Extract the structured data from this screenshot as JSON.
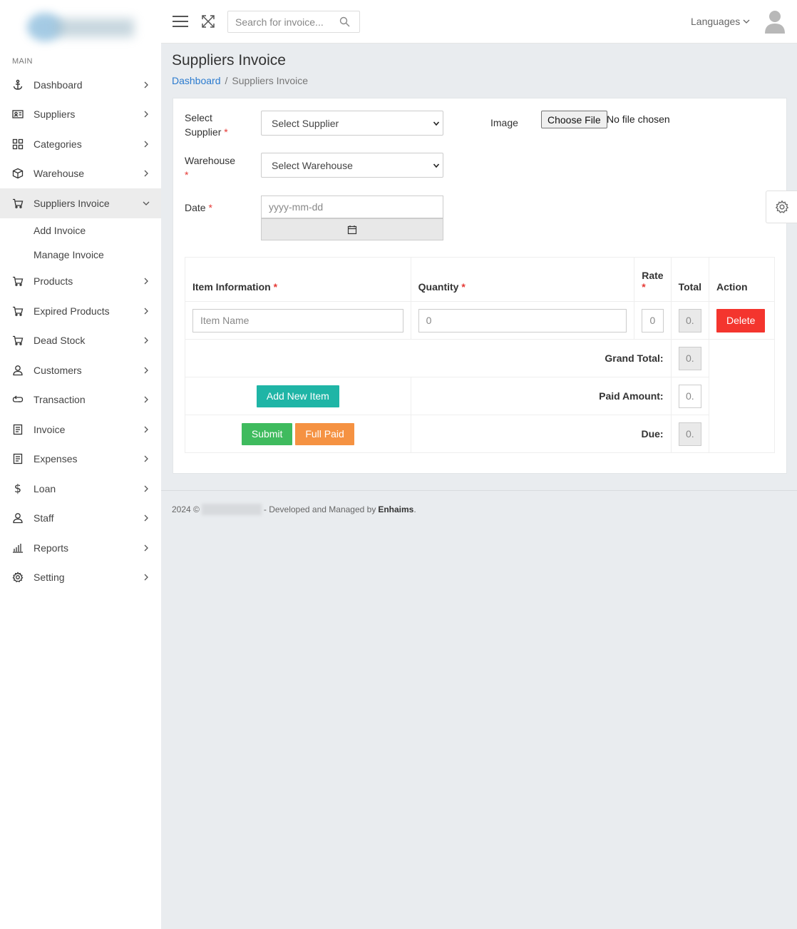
{
  "sidebar": {
    "section": "MAIN",
    "items": [
      {
        "label": "Dashboard",
        "icon": "anchor-icon"
      },
      {
        "label": "Suppliers",
        "icon": "id-card-icon"
      },
      {
        "label": "Categories",
        "icon": "grid-icon"
      },
      {
        "label": "Warehouse",
        "icon": "box-icon"
      },
      {
        "label": "Suppliers Invoice",
        "icon": "cart-icon",
        "active": true
      },
      {
        "label": "Products",
        "icon": "cart-icon"
      },
      {
        "label": "Expired Products",
        "icon": "cart-icon"
      },
      {
        "label": "Dead Stock",
        "icon": "cart-icon"
      },
      {
        "label": "Customers",
        "icon": "user-icon"
      },
      {
        "label": "Transaction",
        "icon": "exchange-icon"
      },
      {
        "label": "Invoice",
        "icon": "document-icon"
      },
      {
        "label": "Expenses",
        "icon": "document-icon"
      },
      {
        "label": "Loan",
        "icon": "dollar-icon"
      },
      {
        "label": "Staff",
        "icon": "user-icon"
      },
      {
        "label": "Reports",
        "icon": "bar-chart-icon"
      },
      {
        "label": "Setting",
        "icon": "gear-icon"
      }
    ],
    "subitems": [
      "Add Invoice",
      "Manage Invoice"
    ]
  },
  "topbar": {
    "search_placeholder": "Search for invoice...",
    "languages": "Languages"
  },
  "page": {
    "title": "Suppliers Invoice",
    "breadcrumb_home": "Dashboard",
    "breadcrumb_sep": "/",
    "breadcrumb_current": "Suppliers Invoice"
  },
  "form": {
    "supplier_label": "Select Supplier",
    "supplier_value": "Select Supplier",
    "warehouse_label": "Warehouse",
    "warehouse_value": "Select Warehouse",
    "date_label": "Date",
    "date_placeholder": "yyyy-mm-dd",
    "image_label": "Image",
    "file_button": "Choose File",
    "file_status": "No file chosen",
    "required_mark": "*"
  },
  "table": {
    "headers": {
      "item": "Item Information",
      "quantity": "Quantity",
      "rate": "Rate",
      "total": "Total",
      "action": "Action"
    },
    "row": {
      "item_placeholder": "Item Name",
      "quantity": "0",
      "rate": "0",
      "total": "0.",
      "delete": "Delete"
    },
    "grand_total_label": "Grand Total:",
    "grand_total": "0.",
    "paid_label": "Paid Amount:",
    "paid": "0.",
    "due_label": "Due:",
    "due": "0.",
    "add_item": "Add New Item",
    "submit": "Submit",
    "full_paid": "Full Paid"
  },
  "footer": {
    "year": "2024 ©",
    "text": "- Developed and Managed by",
    "company": "Enhaims",
    "dot": "."
  },
  "colors": {
    "link": "#2b7bcf",
    "delete": "#f4352e",
    "add": "#1fb5a6",
    "submit": "#3fbb5e",
    "full_paid": "#f59242",
    "required": "#e53935",
    "background": "#e9ecef"
  }
}
